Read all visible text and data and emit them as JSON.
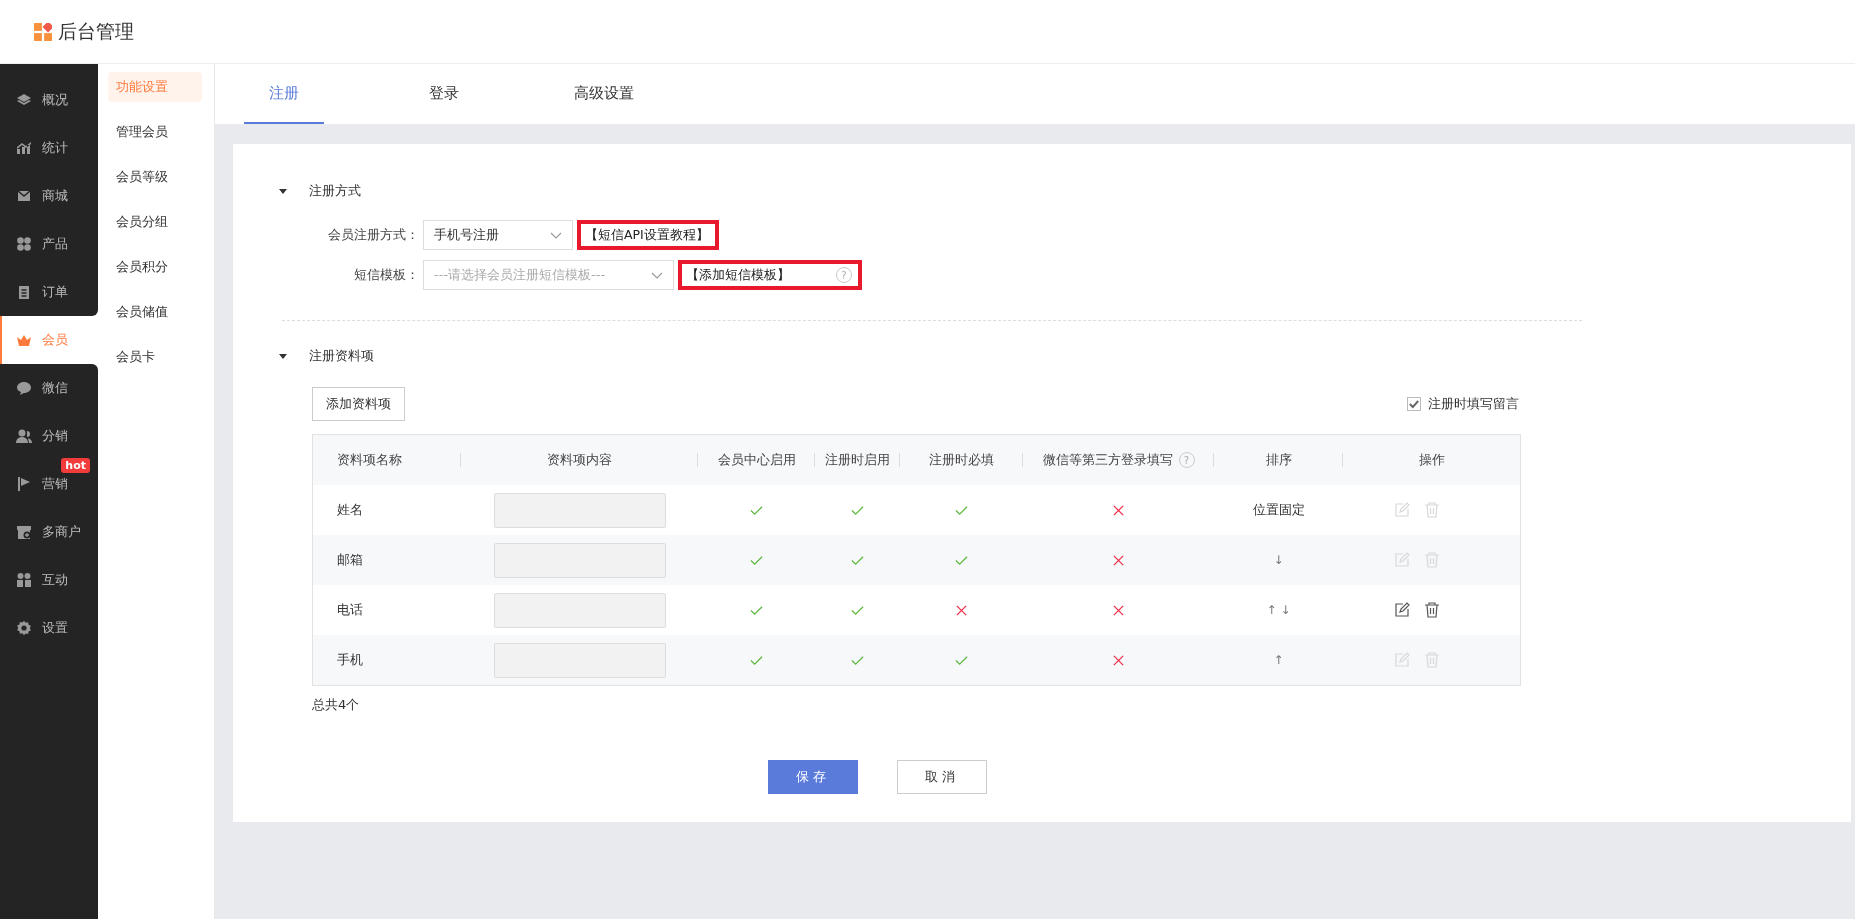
{
  "header": {
    "title": "后台管理"
  },
  "nav": [
    {
      "label": "概况",
      "selected": false
    },
    {
      "label": "统计",
      "selected": false
    },
    {
      "label": "商城",
      "selected": false
    },
    {
      "label": "产品",
      "selected": false
    },
    {
      "label": "订单",
      "selected": false
    },
    {
      "label": "会员",
      "selected": true
    },
    {
      "label": "微信",
      "selected": false
    },
    {
      "label": "分销",
      "selected": false
    },
    {
      "label": "营销",
      "selected": false,
      "badge": "hot"
    },
    {
      "label": "多商户",
      "selected": false
    },
    {
      "label": "互动",
      "selected": false
    },
    {
      "label": "设置",
      "selected": false
    }
  ],
  "subnav": [
    {
      "label": "功能设置",
      "selected": true
    },
    {
      "label": "管理会员",
      "selected": false
    },
    {
      "label": "会员等级",
      "selected": false
    },
    {
      "label": "会员分组",
      "selected": false
    },
    {
      "label": "会员积分",
      "selected": false
    },
    {
      "label": "会员储值",
      "selected": false
    },
    {
      "label": "会员卡",
      "selected": false
    }
  ],
  "tabs": [
    {
      "label": "注册",
      "selected": true
    },
    {
      "label": "登录",
      "selected": false
    },
    {
      "label": "高级设置",
      "selected": false
    }
  ],
  "register_method": {
    "title": "注册方式",
    "fields": [
      {
        "label": "会员注册方式：",
        "value": "手机号注册",
        "link": "【短信API设置教程】"
      },
      {
        "label": "短信模板：",
        "placeholder": "---请选择会员注册短信模板---",
        "link": "【添加短信模板】",
        "help": "?"
      }
    ]
  },
  "profile": {
    "title": "注册资料项",
    "add_button": "添加资料项",
    "remark_checkbox": {
      "label": "注册时填写留言",
      "checked": true
    },
    "columns": [
      {
        "label": "资料项名称"
      },
      {
        "label": "资料项内容"
      },
      {
        "label": "会员中心启用"
      },
      {
        "label": "注册时启用"
      },
      {
        "label": "注册时必填"
      },
      {
        "label": "微信等第三方登录填写",
        "help": "?"
      },
      {
        "label": "排序"
      },
      {
        "label": "操作"
      }
    ],
    "rows": [
      {
        "name": "姓名",
        "member_center": true,
        "on_register": true,
        "required": true,
        "third_party": false,
        "sort": "位置固定",
        "actions_enabled": false
      },
      {
        "name": "邮箱",
        "member_center": true,
        "on_register": true,
        "required": true,
        "third_party": false,
        "sort": "↓",
        "actions_enabled": false
      },
      {
        "name": "电话",
        "member_center": true,
        "on_register": true,
        "required": false,
        "third_party": false,
        "sort": "↑ ↓",
        "actions_enabled": true
      },
      {
        "name": "手机",
        "member_center": true,
        "on_register": true,
        "required": true,
        "third_party": false,
        "sort": "↑",
        "actions_enabled": false
      }
    ],
    "total": "总共4个"
  },
  "buttons": [
    {
      "label": "保存",
      "kind": "primary"
    },
    {
      "label": "取消",
      "kind": "default"
    }
  ]
}
